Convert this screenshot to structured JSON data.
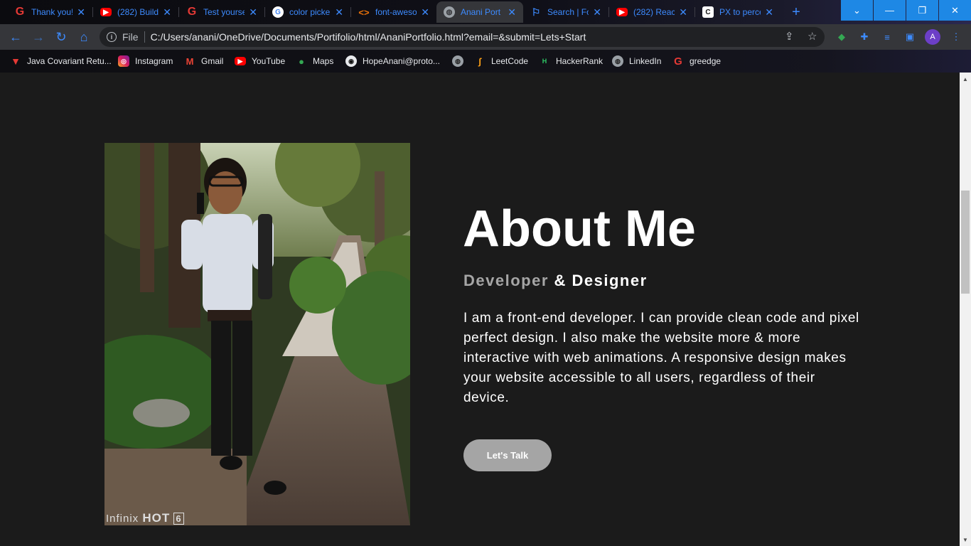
{
  "tabs": [
    {
      "title": "Thank you!",
      "favicon": "grammarly-icon",
      "color": "#e53935"
    },
    {
      "title": "(282) Build",
      "favicon": "youtube-icon",
      "color": "#ff0000"
    },
    {
      "title": "Test yourse",
      "favicon": "grammarly-icon",
      "color": "#e53935"
    },
    {
      "title": "color picke",
      "favicon": "google-icon",
      "color": "#4285f4"
    },
    {
      "title": "font-aweso",
      "favicon": "code-icon",
      "color": "#e8710a"
    },
    {
      "title": "Anani Port",
      "favicon": "globe-icon",
      "color": "#9aa0a6",
      "active": true
    },
    {
      "title": "Search | Fo",
      "favicon": "flag-icon",
      "color": "#3d8bff"
    },
    {
      "title": "(282) React",
      "favicon": "youtube-icon",
      "color": "#ff0000"
    },
    {
      "title": "PX to perce",
      "favicon": "c-icon",
      "color": "#ffffff"
    }
  ],
  "omnibox": {
    "scheme": "File",
    "url": "C:/Users/anani/OneDrive/Documents/Portifolio/html/AnaniPortfolio.html?email=&submit=Lets+Start"
  },
  "profile_initial": "A",
  "bookmarks": [
    {
      "label": "Java Covariant Retu...",
      "icon": "triangle-logo-icon"
    },
    {
      "label": "Instagram",
      "icon": "instagram-icon"
    },
    {
      "label": "Gmail",
      "icon": "gmail-icon"
    },
    {
      "label": "YouTube",
      "icon": "youtube-icon"
    },
    {
      "label": "Maps",
      "icon": "maps-pin-icon"
    },
    {
      "label": "HopeAnani@proto...",
      "icon": "account-icon"
    },
    {
      "label": "",
      "icon": "globe-icon"
    },
    {
      "label": "LeetCode",
      "icon": "leetcode-icon"
    },
    {
      "label": "HackerRank",
      "icon": "hackerrank-icon"
    },
    {
      "label": "LinkedIn",
      "icon": "globe-icon"
    },
    {
      "label": "greedge",
      "icon": "grammarly-icon"
    }
  ],
  "about": {
    "title": "About Me",
    "role_muted": "Developer",
    "role_bright": "& Designer",
    "bio": "I am a front-end developer. I can provide clean code and pixel perfect design. I also make the website more & more interactive with web animations. A responsive design makes your website accessible to all users, regardless of their device.",
    "cta_label": "Let's Talk"
  },
  "photo": {
    "watermark_brand": "Infinix",
    "watermark_model": "HOT",
    "watermark_number": "6"
  },
  "colors": {
    "page_bg": "#1b1b1b",
    "accent_blue": "#3d8bff",
    "button_gray": "#a5a5a5",
    "muted_text": "#a6a6a6"
  }
}
